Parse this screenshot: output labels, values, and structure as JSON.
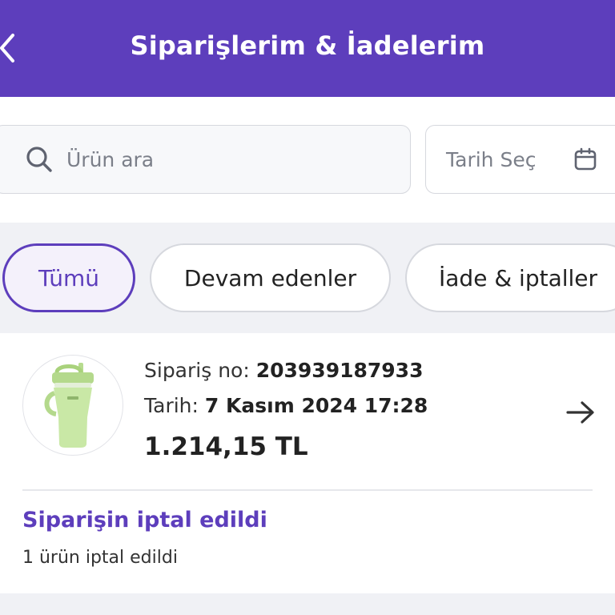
{
  "header": {
    "title": "Siparişlerim & İadelerim",
    "back_icon": "chevron-left-icon",
    "background": "#5d3ebc"
  },
  "search": {
    "placeholder": "Ürün ara",
    "value": "",
    "icon": "search-icon"
  },
  "date_picker": {
    "label": "Tarih Seç",
    "icon": "calendar-icon"
  },
  "filters": [
    {
      "label": "Tümü",
      "active": true
    },
    {
      "label": "Devam edenler",
      "active": false
    },
    {
      "label": "İade & iptaller",
      "active": false
    }
  ],
  "orders": [
    {
      "order_no_label": "Sipariş no:",
      "order_no": "203939187933",
      "date_label": "Tarih:",
      "date": "7 Kasım 2024 17:28",
      "price": "1.214,15 TL",
      "status_title": "Siparişin iptal edildi",
      "status_detail": "1 ürün iptal edildi",
      "product_icon": "tumbler-bottle-icon"
    }
  ],
  "colors": {
    "accent": "#5d3ebc",
    "product": "#c9e8a6"
  }
}
